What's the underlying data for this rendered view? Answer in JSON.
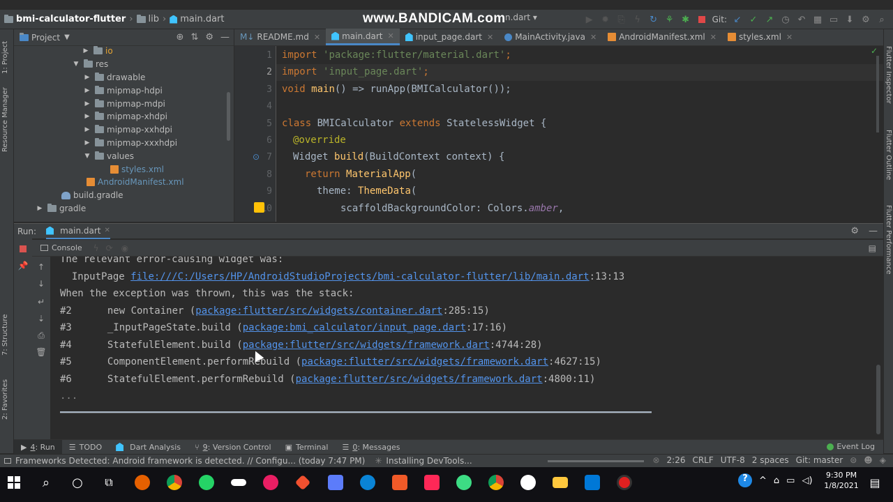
{
  "navbar": {
    "project": "bmi-calculator-flutter",
    "folder": "lib",
    "file": "main.dart",
    "watermark": "www.BANDICAM.com",
    "run_config": "n.dart",
    "vcs_label": "Git:"
  },
  "left_strip": {
    "project_tab": "1: Project",
    "resource_tab": "Resource Manager",
    "structure_tab": "7: Structure",
    "favorites_tab": "2: Favorites"
  },
  "right_strip": {
    "inspector": "Flutter Inspector",
    "outline": "Flutter Outline",
    "performance": "Flutter Performance"
  },
  "project_panel": {
    "title": "Project",
    "tree": [
      {
        "label": "io",
        "type": "folder",
        "expanded": false
      },
      {
        "label": "res",
        "type": "folder",
        "expanded": true
      },
      {
        "label": "drawable",
        "type": "folder",
        "expanded": false
      },
      {
        "label": "mipmap-hdpi",
        "type": "folder",
        "expanded": false
      },
      {
        "label": "mipmap-mdpi",
        "type": "folder",
        "expanded": false
      },
      {
        "label": "mipmap-xhdpi",
        "type": "folder",
        "expanded": false
      },
      {
        "label": "mipmap-xxhdpi",
        "type": "folder",
        "expanded": false
      },
      {
        "label": "mipmap-xxxhdpi",
        "type": "folder",
        "expanded": false
      },
      {
        "label": "values",
        "type": "folder",
        "expanded": true
      },
      {
        "label": "styles.xml",
        "type": "xml"
      },
      {
        "label": "AndroidManifest.xml",
        "type": "xml"
      },
      {
        "label": "build.gradle",
        "type": "gradle"
      },
      {
        "label": "gradle",
        "type": "folder",
        "expanded": false
      }
    ]
  },
  "editor_tabs": [
    {
      "label": "README.md",
      "active": false
    },
    {
      "label": "main.dart",
      "active": true
    },
    {
      "label": "input_page.dart",
      "active": false
    },
    {
      "label": "MainActivity.java",
      "active": false
    },
    {
      "label": "AndroidManifest.xml",
      "active": false
    },
    {
      "label": "styles.xml",
      "active": false
    }
  ],
  "code": {
    "line_numbers": [
      "1",
      "2",
      "3",
      "4",
      "5",
      "6",
      "7",
      "8",
      "9",
      "10"
    ],
    "l1_kw": "import",
    "l1_str": "'package:flutter/material.dart'",
    "l1_end": ";",
    "l2_kw": "import",
    "l2_str": "'input_page.dart'",
    "l2_end": ";",
    "l3_kw": "void",
    "l3_fn": "main",
    "l3_rest": "() => runApp(BMICalculator());",
    "l5_kw": "class",
    "l5_name": "BMICalculator",
    "l5_kw2": "extends",
    "l5_rest": "StatelessWidget {",
    "l6_ann": "@override",
    "l7_type": "Widget",
    "l7_fn": "build",
    "l7_rest": "(BuildContext context) {",
    "l8_kw": "return",
    "l8_fn": "MaterialApp",
    "l8_rest": "(",
    "l9_pre": "theme: ",
    "l9_fn": "ThemeData",
    "l9_rest": "(",
    "l10_pre": "scaffoldBackgroundColor: Colors.",
    "l10_it": "amber",
    "l10_end": ","
  },
  "run_panel": {
    "label": "Run:",
    "tab": "main.dart",
    "console_tab": "Console"
  },
  "console": {
    "line0": "The relevant error-causing widget was:",
    "line1_pre": "  InputPage ",
    "line1_link": "file:///C:/Users/HP/AndroidStudioProjects/bmi-calculator-flutter/lib/main.dart",
    "line1_post": ":13:13",
    "line2": "When the exception was thrown, this was the stack:",
    "frames": [
      {
        "num": "#2",
        "fn": "new Container (",
        "link": "package:flutter/src/widgets/container.dart",
        "pos": ":285:15)"
      },
      {
        "num": "#3",
        "fn": "_InputPageState.build (",
        "link": "package:bmi_calculator/input_page.dart",
        "pos": ":17:16)"
      },
      {
        "num": "#4",
        "fn": "StatefulElement.build (",
        "link": "package:flutter/src/widgets/framework.dart",
        "pos": ":4744:28)"
      },
      {
        "num": "#5",
        "fn": "ComponentElement.performRebuild (",
        "link": "package:flutter/src/widgets/framework.dart",
        "pos": ":4627:15)"
      },
      {
        "num": "#6",
        "fn": "StatefulElement.performRebuild (",
        "link": "package:flutter/src/widgets/framework.dart",
        "pos": ":4800:11)"
      }
    ],
    "ellipsis": "..."
  },
  "tool_tabs": [
    {
      "key": "4",
      "label": ": Run",
      "active": true
    },
    {
      "key": "",
      "label": "TODO",
      "active": false
    },
    {
      "key": "",
      "label": "Dart Analysis",
      "active": false
    },
    {
      "key": "9",
      "label": ": Version Control",
      "active": false
    },
    {
      "key": "",
      "label": "Terminal",
      "active": false
    },
    {
      "key": "0",
      "label": ": Messages",
      "active": false
    }
  ],
  "event_log": "Event Log",
  "status": {
    "message": "Frameworks Detected: Android framework is detected. // Configu... (today 7:47 PM)",
    "task": "Installing DevTools...",
    "position": "2:26",
    "line_sep": "CRLF",
    "encoding": "UTF-8",
    "indent": "2 spaces",
    "branch": "Git: master"
  },
  "taskbar": {
    "time": "9:30 PM",
    "date": "1/8/2021"
  },
  "colors": {
    "keyword": "#cc7832",
    "string": "#6a8759",
    "function": "#ffc66d",
    "link": "#5394ec",
    "accent": "#4a88c7"
  }
}
